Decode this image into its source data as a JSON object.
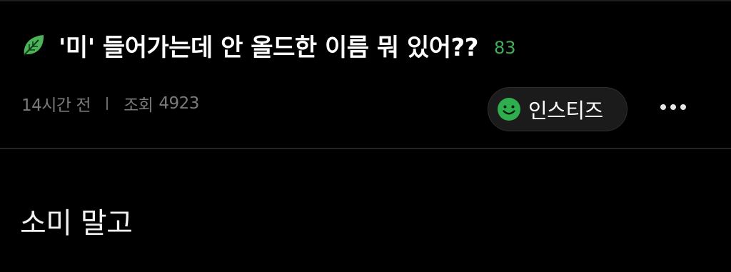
{
  "post": {
    "title": "'미' 들어가는데 안 올드한 이름 뭐 있어??",
    "comment_count": "83",
    "time_ago": "14시간 전",
    "views_label": "조회",
    "views_count": "4923",
    "category": "인스티즈",
    "body": "소미 말고"
  },
  "icons": {
    "title_icon": "leaf-icon",
    "category_icon": "smile-icon",
    "more_icon": "more-horizontal-icon"
  },
  "colors": {
    "background": "#000000",
    "comment_count": "#3fae5a",
    "leaf_green": "#4cb35a",
    "smile_green": "#2fae4e",
    "meta_text": "#7a7a7a"
  }
}
